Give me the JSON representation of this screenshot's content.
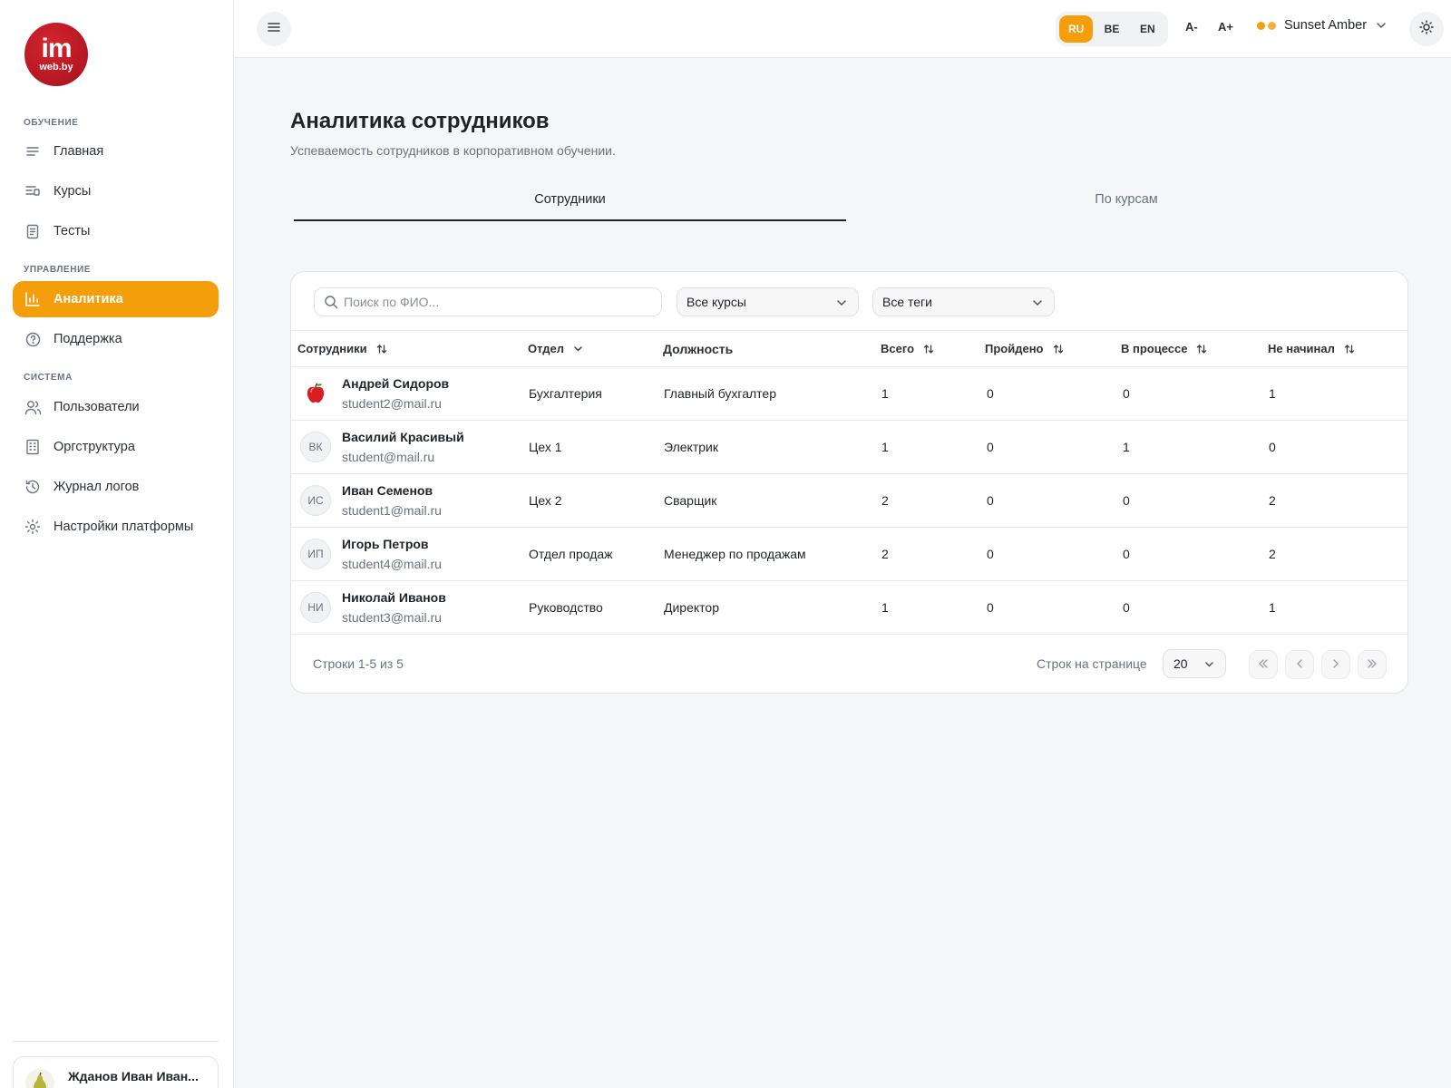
{
  "logo": {
    "main": "im",
    "sub": "web.by"
  },
  "sidebar": {
    "sections": [
      {
        "title": "Обучение"
      },
      {
        "title": "Управление"
      },
      {
        "title": "Система"
      }
    ],
    "items": [
      {
        "label": "Главная",
        "icon": "menu-lines-icon"
      },
      {
        "label": "Курсы",
        "icon": "course-list-icon"
      },
      {
        "label": "Тесты",
        "icon": "document-icon"
      },
      {
        "label": "Аналитика",
        "icon": "bar-chart-icon",
        "active": true
      },
      {
        "label": "Поддержка",
        "icon": "help-circle-icon"
      },
      {
        "label": "Пользователи",
        "icon": "users-icon"
      },
      {
        "label": "Оргструктура",
        "icon": "building-icon"
      },
      {
        "label": "Журнал логов",
        "icon": "history-icon"
      },
      {
        "label": "Настройки платформы",
        "icon": "settings-icon"
      }
    ],
    "user": {
      "name": "Жданов Иван Иван...",
      "avatar_icon": "pear-icon"
    }
  },
  "topbar": {
    "languages": [
      "RU",
      "BE",
      "EN"
    ],
    "active_language": "RU",
    "font_decrease": "A-",
    "font_increase": "A+",
    "theme": "Sunset Amber",
    "accent_color": "#f59e0b"
  },
  "page": {
    "title": "Аналитика сотрудников",
    "subtitle": "Успеваемость сотрудников в корпоративном обучении."
  },
  "tabs": [
    {
      "label": "Сотрудники",
      "active": true
    },
    {
      "label": "По курсам",
      "active": false
    }
  ],
  "filters": {
    "search_placeholder": "Поиск по ФИО...",
    "course_select": "Все курсы",
    "tags_select": "Все теги"
  },
  "table": {
    "columns": {
      "employees": "Сотрудники",
      "department": "Отдел",
      "position": "Должность",
      "total": "Всего",
      "passed": "Пройдено",
      "in_progress": "В процессе",
      "not_started": "Не начинал"
    },
    "rows": [
      {
        "initials": "",
        "avatar_icon": "apple-icon",
        "name": "Андрей Сидоров",
        "email": "student2@mail.ru",
        "department": "Бухгалтерия",
        "position": "Главный бухгалтер",
        "total": "1",
        "passed": "0",
        "in_progress": "0",
        "not_started": "1"
      },
      {
        "initials": "ВК",
        "name": "Василий Красивый",
        "email": "student@mail.ru",
        "department": "Цех 1",
        "position": "Электрик",
        "total": "1",
        "passed": "0",
        "in_progress": "1",
        "not_started": "0"
      },
      {
        "initials": "ИС",
        "name": "Иван Семенов",
        "email": "student1@mail.ru",
        "department": "Цех 2",
        "position": "Сварщик",
        "total": "2",
        "passed": "0",
        "in_progress": "0",
        "not_started": "2"
      },
      {
        "initials": "ИП",
        "name": "Игорь Петров",
        "email": "student4@mail.ru",
        "department": "Отдел продаж",
        "position": "Менеджер по продажам",
        "total": "2",
        "passed": "0",
        "in_progress": "0",
        "not_started": "2"
      },
      {
        "initials": "НИ",
        "name": "Николай Иванов",
        "email": "student3@mail.ru",
        "department": "Руководство",
        "position": "Директор",
        "total": "1",
        "passed": "0",
        "in_progress": "0",
        "not_started": "1"
      }
    ]
  },
  "pagination": {
    "summary": "Строки 1-5 из 5",
    "rows_per_page_label": "Строк на странице",
    "rows_per_page": "20"
  }
}
